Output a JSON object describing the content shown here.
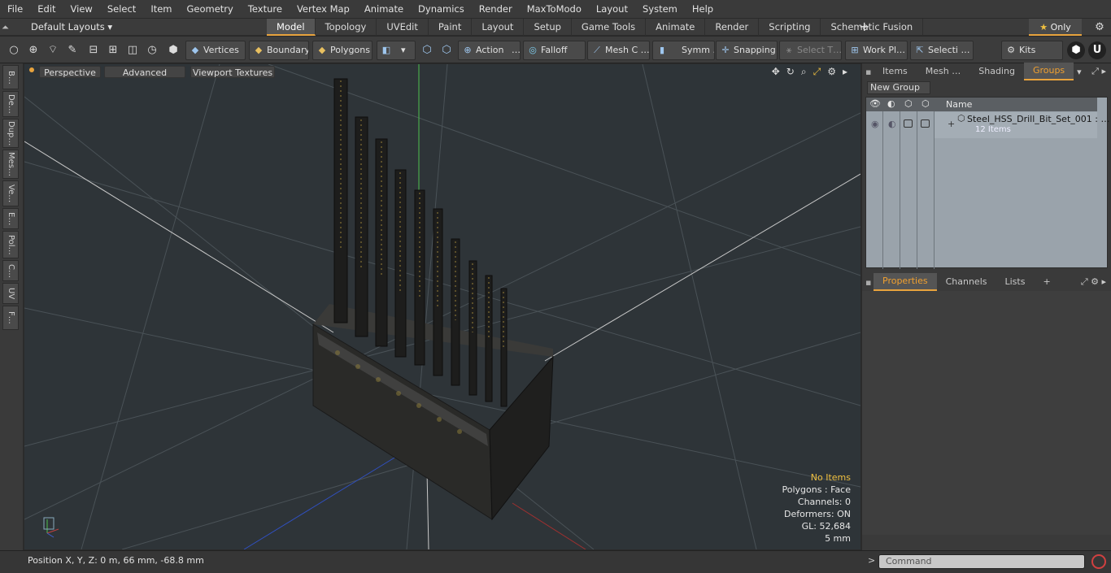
{
  "menu": [
    "File",
    "Edit",
    "View",
    "Select",
    "Item",
    "Geometry",
    "Texture",
    "Vertex Map",
    "Animate",
    "Dynamics",
    "Render",
    "MaxToModo",
    "Layout",
    "System",
    "Help"
  ],
  "layout": {
    "name": "Default Layouts ▾"
  },
  "tabs": [
    "Model",
    "Topology",
    "UVEdit",
    "Paint",
    "Layout",
    "Setup",
    "Game Tools",
    "Animate",
    "Render",
    "Scripting",
    "Schematic Fusion"
  ],
  "only_label": "Only",
  "toolbar": {
    "vertices": "Vertices",
    "boundary": "Boundary",
    "polygons": "Polygons",
    "action": "Action",
    "action_more": "…",
    "falloff": "Falloff",
    "mesh": "Mesh C …",
    "symm": "Symm …",
    "snapping": "Snapping",
    "select_t": "Select T…",
    "work_pl": "Work Pl…",
    "selecti": "Selecti …",
    "kits": "Kits"
  },
  "left_tabs": [
    "B…",
    "De…",
    "Dup…",
    "Mes…",
    "Ve…",
    "E…",
    "Pol…",
    "C…",
    "UV",
    "F…"
  ],
  "viewport": {
    "perspective": "Perspective",
    "advanced": "Advanced",
    "viewport_textures": "Viewport Textures",
    "info": {
      "no_items": "No Items",
      "polygons": "Polygons : Face",
      "channels": "Channels: 0",
      "deformers": "Deformers: ON",
      "gl": "GL: 52,684",
      "scale": "5 mm"
    }
  },
  "status": {
    "position": "Position X, Y, Z:   0 m, 66 mm, -68.8 mm"
  },
  "right_panel": {
    "top_tabs": [
      "Items",
      "Mesh …",
      "Shading",
      "Groups"
    ],
    "new_group": "New Group",
    "name_header": "Name",
    "group_name": "Steel_HSS_Drill_Bit_Set_001 : …",
    "group_count": "12 Items",
    "bottom_tabs": [
      "Properties",
      "Channels",
      "Lists"
    ],
    "plus": "+"
  },
  "command": {
    "placeholder": "Command"
  },
  "colors": {
    "accent": "#e8a33d",
    "viewport_bg": "#2e3438",
    "info_warn": "#f0c040"
  }
}
